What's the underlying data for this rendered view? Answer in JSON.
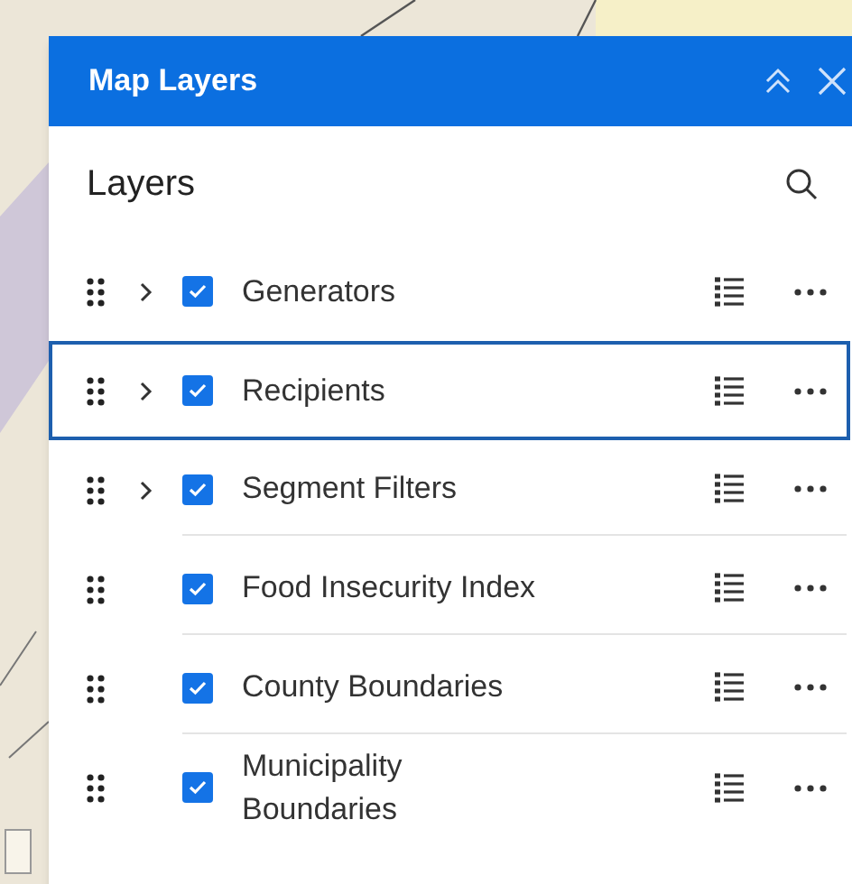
{
  "panel": {
    "title": "Map Layers"
  },
  "section": {
    "title": "Layers"
  },
  "layers": [
    {
      "name": "Generators",
      "expandable": true,
      "checked": true,
      "selected": false
    },
    {
      "name": "Recipients",
      "expandable": true,
      "checked": true,
      "selected": true
    },
    {
      "name": "Segment Filters",
      "expandable": true,
      "checked": true,
      "selected": false
    },
    {
      "name": "Food Insecurity Index",
      "expandable": false,
      "checked": true,
      "selected": false
    },
    {
      "name": "County Boundaries",
      "expandable": false,
      "checked": true,
      "selected": false
    },
    {
      "name": "Municipality Boundaries",
      "expandable": false,
      "checked": true,
      "selected": false
    }
  ]
}
